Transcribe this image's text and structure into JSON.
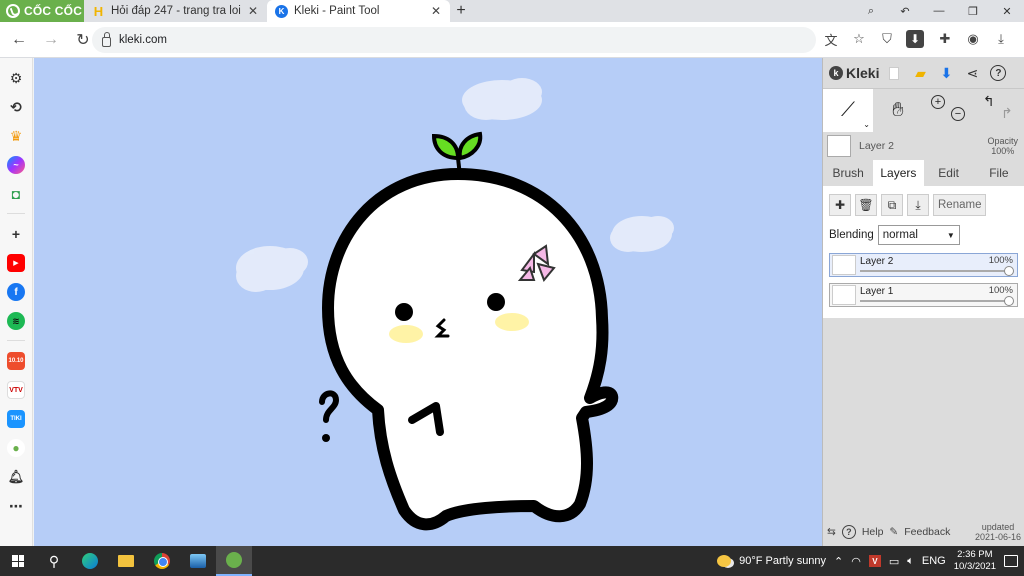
{
  "browser": {
    "brand": "CỐC CỐC",
    "tabs": [
      {
        "title": "Hỏi đáp 247 - trang tra loi",
        "active": false
      },
      {
        "title": "Kleki - Paint Tool",
        "active": true
      }
    ],
    "url": "kleki.com"
  },
  "kleki": {
    "logo": "Kleki",
    "current_layer": "Layer 2",
    "opacity_label": "Opacity",
    "opacity_value": "100%",
    "tabs": [
      "Brush",
      "Layers",
      "Edit",
      "File"
    ],
    "active_tab": "Layers",
    "rename_label": "Rename",
    "blending_label": "Blending",
    "blending_value": "normal",
    "layers": [
      {
        "name": "Layer 2",
        "opacity": "100%",
        "opacity_value": 1.0,
        "selected": true
      },
      {
        "name": "Layer 1",
        "opacity": "100%",
        "opacity_value": 1.0,
        "selected": false
      }
    ],
    "footer": {
      "help": "Help",
      "feedback": "Feedback",
      "updated_label": "updated",
      "updated_date": "2021-06-16"
    }
  },
  "taskbar": {
    "weather": "90°F  Partly sunny",
    "lang": "ENG",
    "time": "2:36 PM",
    "date": "10/3/2021"
  },
  "colors": {
    "canvas_bg": "#b6cdf7",
    "brand_green": "#6ab04c",
    "panel_bg": "#dcdcdc"
  }
}
